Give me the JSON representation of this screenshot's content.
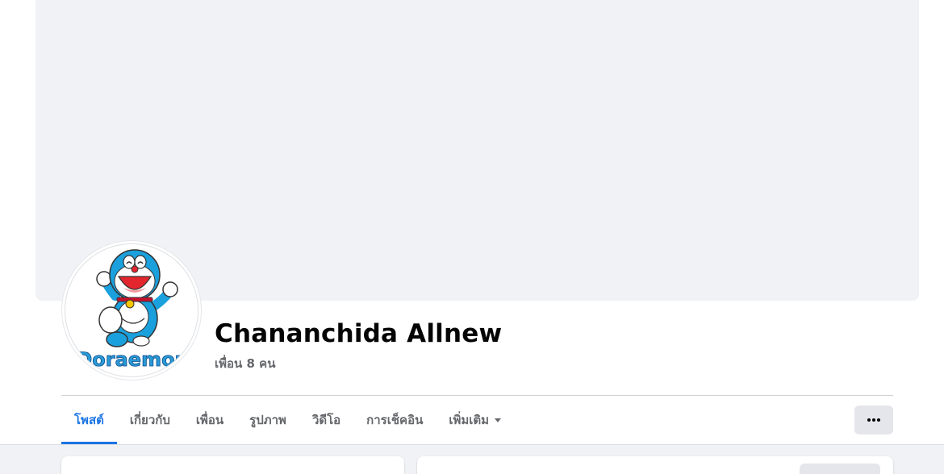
{
  "profile": {
    "name": "Chananchida Allnew",
    "friends": "เพื่อน 8 คน",
    "avatar_icon": "doraemon-avatar"
  },
  "tabs": [
    {
      "label": "โพสต์",
      "active": true
    },
    {
      "label": "เกี่ยวกับ",
      "active": false
    },
    {
      "label": "เพื่อน",
      "active": false
    },
    {
      "label": "รูปภาพ",
      "active": false
    },
    {
      "label": "วิดีโอ",
      "active": false
    },
    {
      "label": "การเช็คอิน",
      "active": false
    },
    {
      "label": "เพิ่มเติม",
      "active": false
    }
  ],
  "more_actions_icon": "ellipsis-icon",
  "colors": {
    "accent": "#1b74e4",
    "cover": "#f0f2f5",
    "secondary_text": "#65676b",
    "primary_text": "#050505"
  }
}
